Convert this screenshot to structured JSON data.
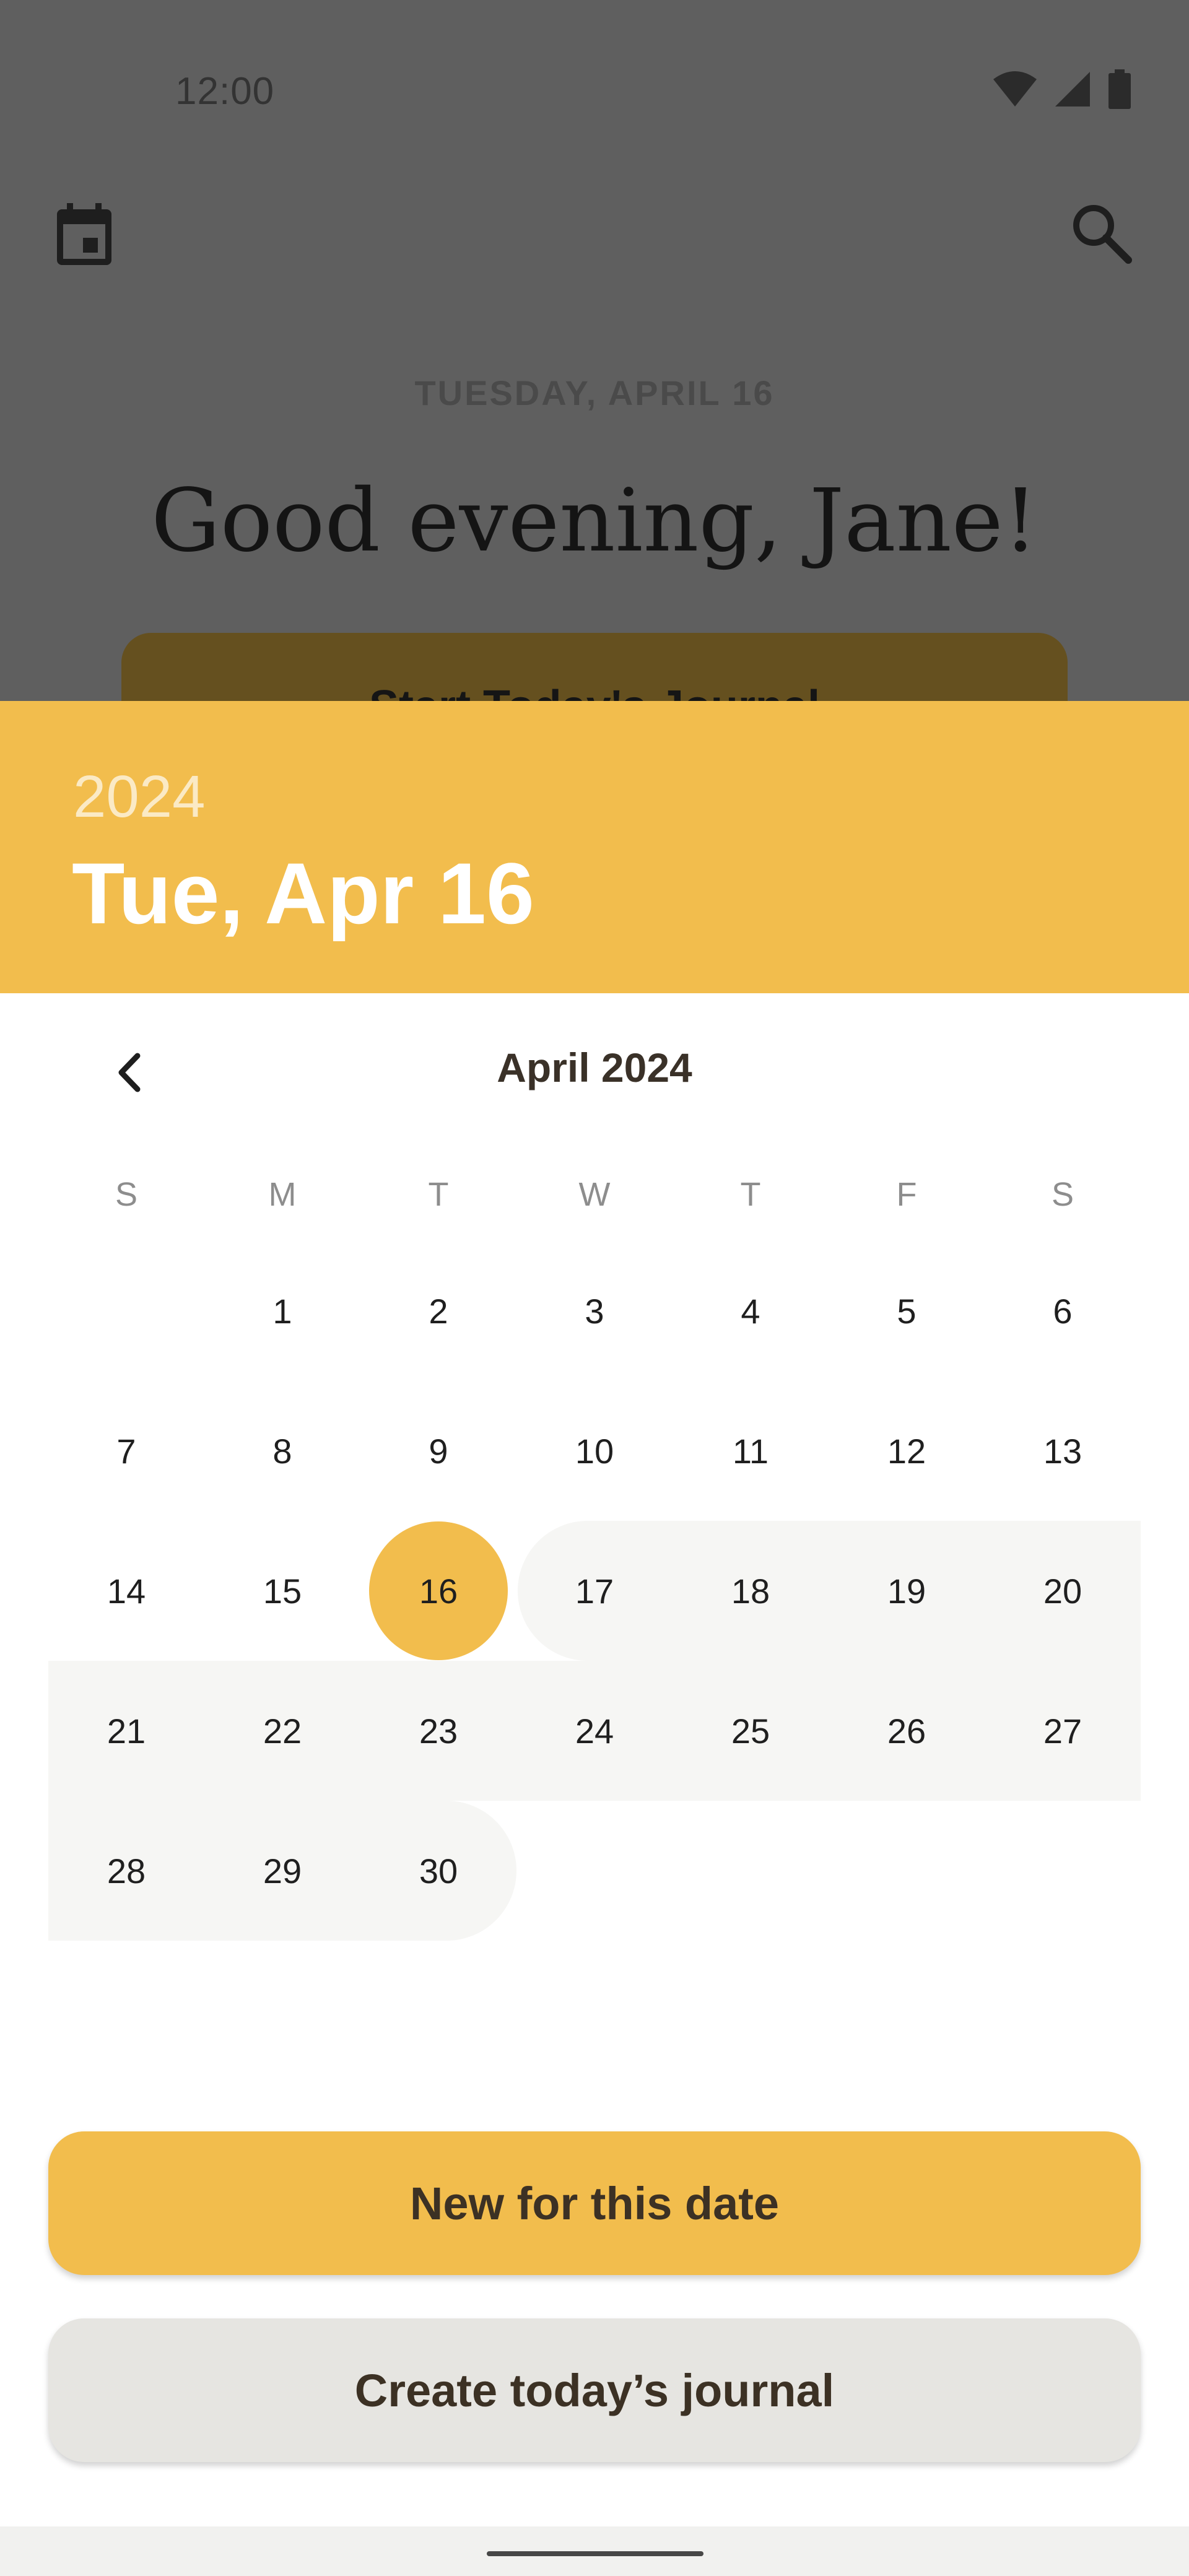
{
  "status_bar": {
    "time": "12:00",
    "icons": [
      "wifi-icon",
      "signal-icon",
      "battery-icon"
    ]
  },
  "app_bar": {
    "left_icon": "calendar-icon",
    "right_icon": "search-icon"
  },
  "home": {
    "date_line": "TUESDAY, APRIL 16",
    "greeting": "Good evening, Jane!",
    "start_button": "Start Today's Journal"
  },
  "date_picker": {
    "year": "2024",
    "selected_date": "Tue, Apr 16",
    "month_title": "April 2024",
    "prev_icon": "chevron-left-icon",
    "weekdays": [
      "S",
      "M",
      "T",
      "W",
      "T",
      "F",
      "S"
    ],
    "days": [
      "1",
      "2",
      "3",
      "4",
      "5",
      "6",
      "7",
      "8",
      "9",
      "10",
      "11",
      "12",
      "13",
      "14",
      "15",
      "16",
      "17",
      "18",
      "19",
      "20",
      "21",
      "22",
      "23",
      "24",
      "25",
      "26",
      "27",
      "28",
      "29",
      "30"
    ],
    "first_weekday_index": 1,
    "selected_day": "16",
    "range_end_day": "30"
  },
  "actions": {
    "new_for_date": "New for this date",
    "create_today": "Create today’s journal"
  },
  "colors": {
    "accent": "#f2bd4d",
    "scrim": "#5f5f5f",
    "range_highlight": "#f6f6f4",
    "secondary_button": "#e6e5e1"
  }
}
